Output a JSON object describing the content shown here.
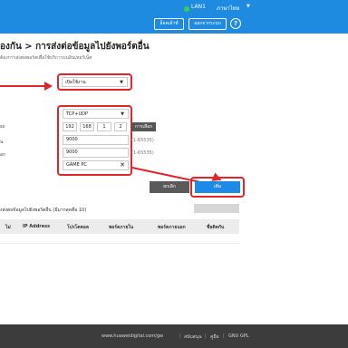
{
  "topbar": {
    "lan_label": "LAN1",
    "lang_label": "ภาษาไทย",
    "logout_label": "ล็อคเอ้าท์",
    "modify_label": "ออกจากระบบ",
    "help_label": "?",
    "bg_color": "#1f8be0",
    "status_color": "#38d14a"
  },
  "page": {
    "title": "องกัน > การส่งต่อข้อมูลไปยังพอร์ตอื่น",
    "subtitle": "ต้องการส่งต่อพอร์ตเพื่อใช้บริการบนอินเทอร์เน็ต"
  },
  "form": {
    "status_select": "เปิดใช้งาน",
    "protocol_select": "TCP+UDP",
    "ip_label": "ss",
    "ip": [
      "192",
      "168",
      "1",
      "2"
    ],
    "ip_button": "การเลือก",
    "internal_port_label": "น",
    "internal_port": "9000",
    "internal_range": "(1-65535)",
    "external_port_label": "อก",
    "external_port": "9000",
    "external_range": "(1-65535)",
    "name": "GAME PC",
    "clear_icon": "close-icon"
  },
  "actions": {
    "cancel_label": "ยกเลิก",
    "add_label": "เพิ่ม"
  },
  "list": {
    "title": "งส่งต่อข้อมูลไปยังพอร์ตอื่น (มีมากสุดคือ 10)",
    "columns": [
      "ไม่",
      "IP Address",
      "โปรโตคอล",
      "พอร์ตภายใน",
      "พอร์ตภายนอก",
      "ชื่อติดกัน"
    ]
  },
  "footer": {
    "website": "www.huaweidigital.com/gw",
    "link1": "สนับสนุน",
    "link2": "คู่มือ",
    "link3": "GNU GPL"
  },
  "annotation_color": "#e0252b"
}
